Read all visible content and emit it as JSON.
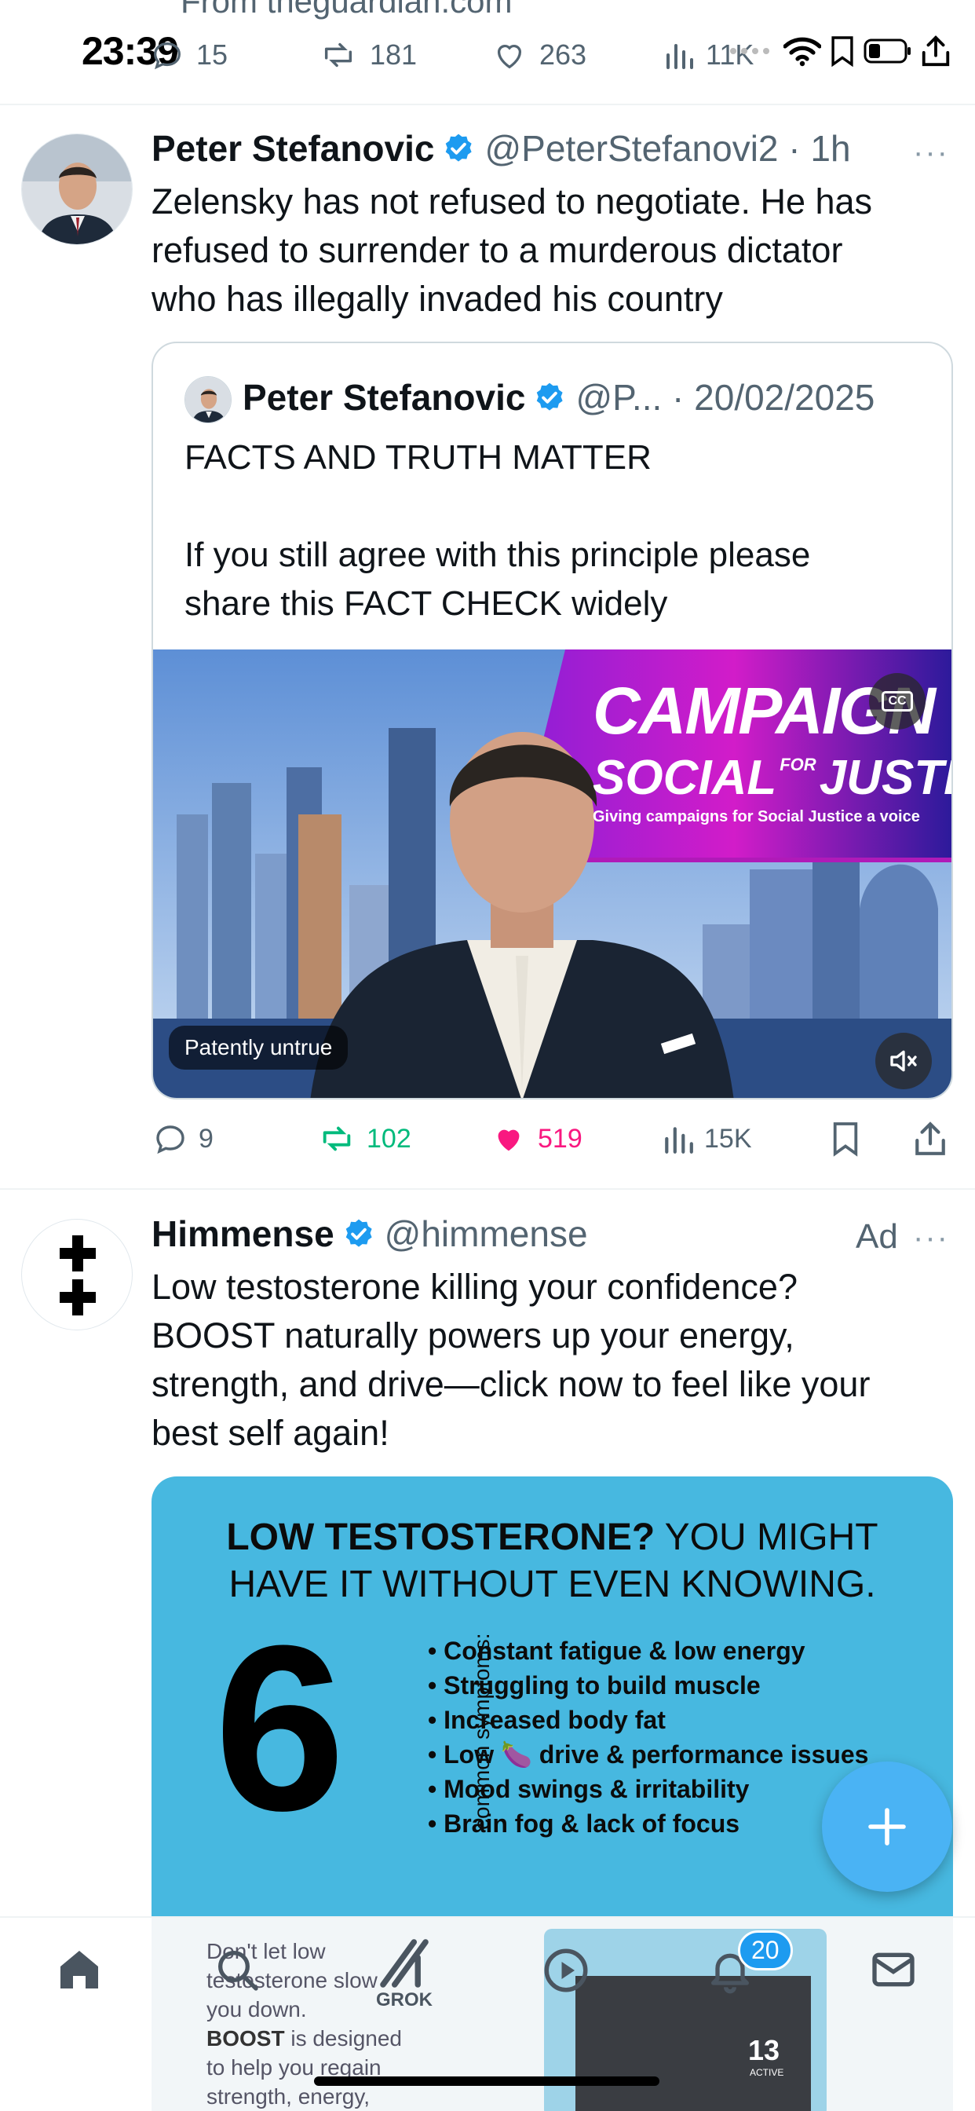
{
  "status_bar": {
    "time": "23:39"
  },
  "previous_tweet": {
    "source_text": "From theguardian.com",
    "replies": "15",
    "reposts": "181",
    "likes": "263",
    "views": "11K"
  },
  "tweet1": {
    "author_name": "Peter Stefanovic",
    "handle_time": "@PeterStefanovi2 · 1h",
    "text": "Zelensky has not refused to negotiate. He has\nrefused to surrender to a murderous dictator\nwho has illegally invaded his country",
    "quote": {
      "author_name": "Peter Stefanovic",
      "handle_date": "@P... · 20/02/2025",
      "text": "FACTS AND TRUTH MATTER\n\nIf you still agree with this principle please\nshare this FACT CHECK widely",
      "video": {
        "banner_line1": "CAMPAIGN",
        "banner_line2a": "SOCIAL",
        "banner_for": "FOR",
        "banner_line2b": "JUSTICE",
        "banner_tagline": "Giving campaigns for Social Justice a voice",
        "caption": "Patently untrue",
        "cc": "CC"
      }
    },
    "actions": {
      "replies": "9",
      "reposts": "102",
      "likes": "519",
      "views": "15K"
    }
  },
  "ad_tweet": {
    "author_name": "Himmense",
    "handle": "@himmense",
    "ad_label": "Ad",
    "text": "Low testosterone killing your confidence?\nBOOST naturally powers up your energy,\nstrength, and drive—click now to feel like your\nbest self again!",
    "creative": {
      "headline_bold": "LOW TESTOSTERONE?",
      "headline_rest1": " YOU MIGHT",
      "headline_rest2": "HAVE IT WITHOUT EVEN KNOWING.",
      "big_number": "6",
      "vertical_label": "common symptoms:",
      "symptoms": [
        "• Constant fatigue & low energy",
        "• Struggling to build muscle",
        "• Increased body fat",
        "• Low 🍆 drive & performance issues",
        "• Mood swings & irritability",
        "• Brain fog & lack of focus"
      ]
    },
    "peek": {
      "text_line": "Don't let low\ntestosterone slow\nyou down.",
      "bold": "BOOST",
      "text_rest": " is designed\nto help you regain\nstrength, energy,",
      "pack_number": "13",
      "pack_label": "ACTIVE"
    }
  },
  "bottom_nav": {
    "grok_label": "GROK",
    "notifications_badge": "20"
  },
  "colors": {
    "accent": "#1d9bf0",
    "repost_green": "#00ba7c",
    "like_pink": "#f91880",
    "secondary_text": "#536471",
    "ad_bg": "#47b8e0"
  }
}
